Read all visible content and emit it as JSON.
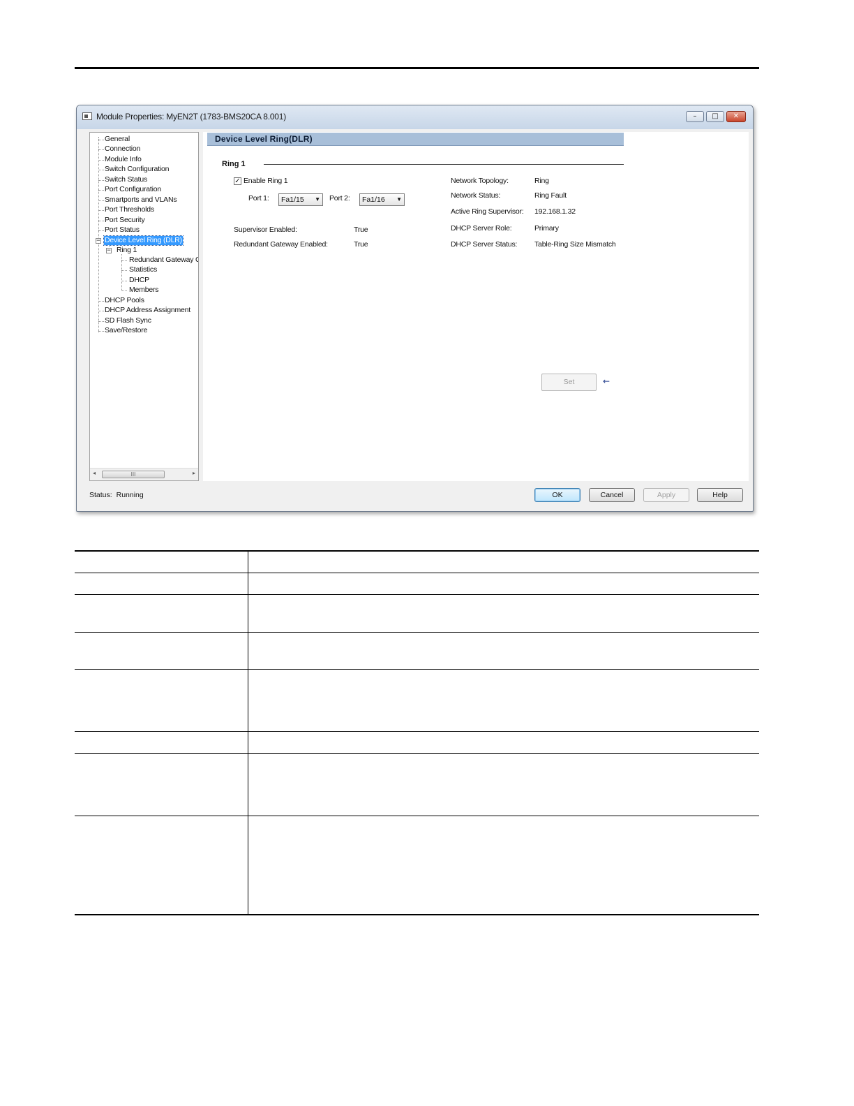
{
  "window": {
    "title": "Module Properties: MyEN2T (1783-BMS20CA 8.001)",
    "minimize_glyph": "–",
    "maximize_glyph": "□",
    "close_glyph": "✕"
  },
  "tree": {
    "items": [
      {
        "label": "General"
      },
      {
        "label": "Connection"
      },
      {
        "label": "Module Info"
      },
      {
        "label": "Switch Configuration"
      },
      {
        "label": "Switch Status"
      },
      {
        "label": "Port Configuration"
      },
      {
        "label": "Smartports and VLANs"
      },
      {
        "label": "Port Thresholds"
      },
      {
        "label": "Port Security"
      },
      {
        "label": "Port Status"
      },
      {
        "label": "Device Level Ring (DLR)",
        "selected": true
      },
      {
        "label": "Ring 1"
      },
      {
        "label": "Redundant Gateway Co"
      },
      {
        "label": "Statistics"
      },
      {
        "label": "DHCP"
      },
      {
        "label": "Members"
      },
      {
        "label": "DHCP Pools"
      },
      {
        "label": "DHCP Address Assignment"
      },
      {
        "label": "SD Flash Sync"
      },
      {
        "label": "Save/Restore"
      }
    ],
    "collapse_glyph": "−",
    "scroll_left": "◂",
    "scroll_right": "▸",
    "scroll_grip": "III"
  },
  "pane": {
    "header": "Device Level Ring(DLR)",
    "ring_title": "Ring 1",
    "enable_ring_label": "Enable Ring 1",
    "enable_ring_checked": true,
    "check_glyph": "✓",
    "port1_label": "Port 1:",
    "port1_value": "Fa1/15",
    "port2_label": "Port 2:",
    "port2_value": "Fa1/16",
    "dropdown_glyph": "▼",
    "supervisor_enabled_label": "Supervisor Enabled:",
    "supervisor_enabled_value": "True",
    "redundant_gateway_label": "Redundant Gateway Enabled:",
    "redundant_gateway_value": "True",
    "network_topology_label": "Network Topology:",
    "network_topology_value": "Ring",
    "network_status_label": "Network Status:",
    "network_status_value": "Ring Fault",
    "active_supervisor_label": "Active Ring Supervisor:",
    "active_supervisor_value": "192.168.1.32",
    "dhcp_role_label": "DHCP Server Role:",
    "dhcp_role_value": "Primary",
    "dhcp_status_label": "DHCP Server Status:",
    "dhcp_status_value": "Table-Ring Size Mismatch",
    "set_button": "Set",
    "set_arrow": "←"
  },
  "footer": {
    "status_label": "Status:",
    "status_value": "Running",
    "ok": "OK",
    "cancel": "Cancel",
    "apply": "Apply",
    "help": "Help"
  }
}
